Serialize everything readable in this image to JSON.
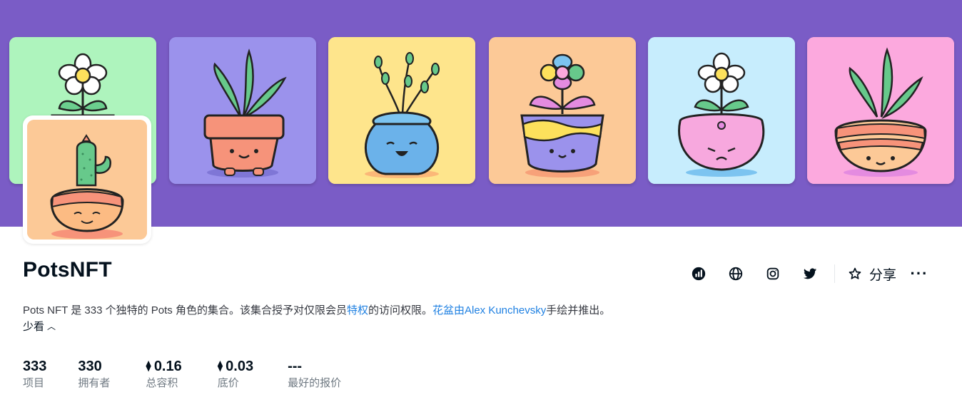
{
  "banner": {
    "background": "#7a5cc6",
    "tiles": [
      {
        "name": "daisy-pot-green",
        "bg": "#aef4bd"
      },
      {
        "name": "terracotta-pot",
        "bg": "#9b92ec"
      },
      {
        "name": "blue-sprout-pot",
        "bg": "#fee58c"
      },
      {
        "name": "purple-flower-pot",
        "bg": "#fcc997"
      },
      {
        "name": "pink-daisy-pot",
        "bg": "#c7edfd"
      },
      {
        "name": "orange-bowl-pot",
        "bg": "#fca9de"
      }
    ]
  },
  "collection": {
    "avatar_icon": "cactus-pot-avatar",
    "name": "PotsNFT",
    "description": {
      "part1": "Pots NFT 是 333 个独特的 Pots 角色的集合。该集合授予对仅限会员",
      "link1": "特权",
      "part2": "的访问权限。",
      "link2": "花盆由Alex Kunchevsky",
      "part3": "手绘并推出。"
    },
    "see_less": "少看"
  },
  "actions": {
    "icons": [
      "activity-icon",
      "globe-icon",
      "instagram-icon",
      "twitter-icon"
    ],
    "share_label": "分享",
    "more_label": "···"
  },
  "stats": [
    {
      "value": "333",
      "label": "项目",
      "eth": false
    },
    {
      "value": "330",
      "label": "拥有者",
      "eth": false
    },
    {
      "value": "0.16",
      "label": "总容积",
      "eth": true
    },
    {
      "value": "0.03",
      "label": "底价",
      "eth": true
    },
    {
      "value": "---",
      "label": "最好的报价",
      "eth": false
    }
  ],
  "colors": {
    "link": "#2081e2",
    "text": "#04111d",
    "muted": "#707a83"
  }
}
